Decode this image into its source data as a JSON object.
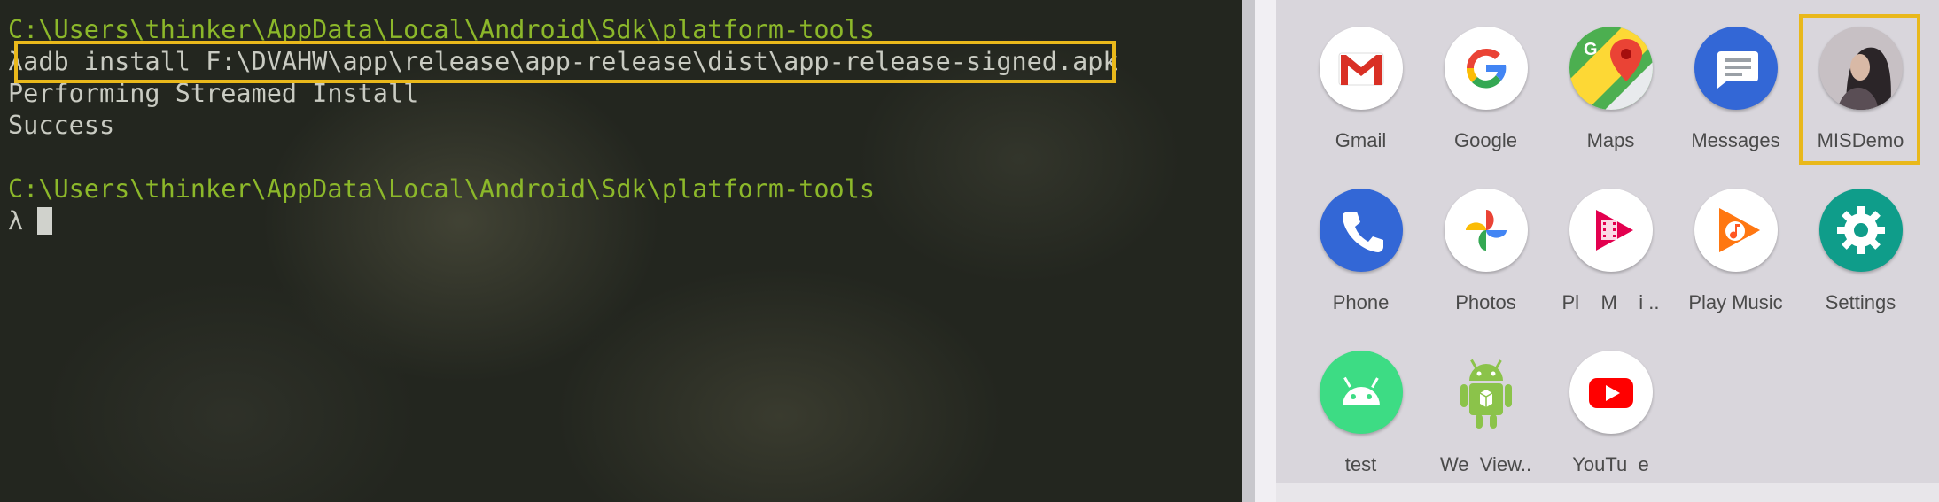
{
  "terminal": {
    "prompt_path_1": "C:\\Users\\thinker\\AppData\\Local\\Android\\Sdk\\platform-tools",
    "prompt_symbol_1": "λ",
    "command": "adb install F:\\DVAHW\\app\\release\\app-release\\dist\\app-release-signed.apk",
    "output_1": "Performing Streamed Install",
    "output_2": "Success",
    "prompt_path_2": "C:\\Users\\thinker\\AppData\\Local\\Android\\Sdk\\platform-tools",
    "prompt_symbol_2": "λ"
  },
  "launcher": {
    "apps": [
      {
        "label": "Gmail",
        "icon": "gmail-icon"
      },
      {
        "label": "Google",
        "icon": "google-icon"
      },
      {
        "label": "Maps",
        "icon": "maps-icon"
      },
      {
        "label": "Messages",
        "icon": "messages-icon"
      },
      {
        "label": "MISDemo",
        "icon": "misdemo-icon"
      },
      {
        "label": "Phone",
        "icon": "phone-icon"
      },
      {
        "label": "Photos",
        "icon": "photos-icon"
      },
      {
        "label": "Pl    M    i ..",
        "icon": "play-movies-icon"
      },
      {
        "label": "Play Music",
        "icon": "play-music-icon"
      },
      {
        "label": "Settings",
        "icon": "settings-icon"
      },
      {
        "label": "test",
        "icon": "android-icon"
      },
      {
        "label": "We  View..",
        "icon": "webview-icon"
      },
      {
        "label": "YouTu  e",
        "icon": "youtube-icon"
      }
    ]
  },
  "colors": {
    "highlight": "#e9b81b",
    "terminal_path": "#8cb82a",
    "terminal_text": "#c9cbc2"
  }
}
